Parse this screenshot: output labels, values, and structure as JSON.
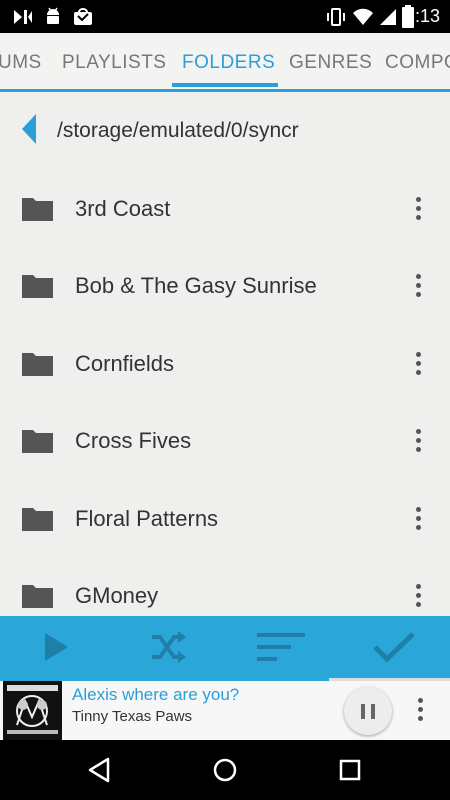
{
  "status_bar": {
    "time": "7:13"
  },
  "tabs": [
    {
      "label": "UMS",
      "active": false
    },
    {
      "label": "PLAYLISTS",
      "active": false
    },
    {
      "label": "FOLDERS",
      "active": true
    },
    {
      "label": "GENRES",
      "active": false
    },
    {
      "label": "COMPO",
      "active": false
    }
  ],
  "path": "/storage/emulated/0/syncr",
  "folders": [
    {
      "name": "3rd Coast"
    },
    {
      "name": "Bob & The Gasy Sunrise"
    },
    {
      "name": "Cornfields"
    },
    {
      "name": "Cross Fives"
    },
    {
      "name": "Floral Patterns"
    },
    {
      "name": "GMoney"
    }
  ],
  "now_playing": {
    "title": "Alexis where are you?",
    "artist": "Tinny Texas Paws",
    "progress": 0.73
  },
  "colors": {
    "accent": "#2aa7d8",
    "accent_text": "#2a9fd8"
  }
}
